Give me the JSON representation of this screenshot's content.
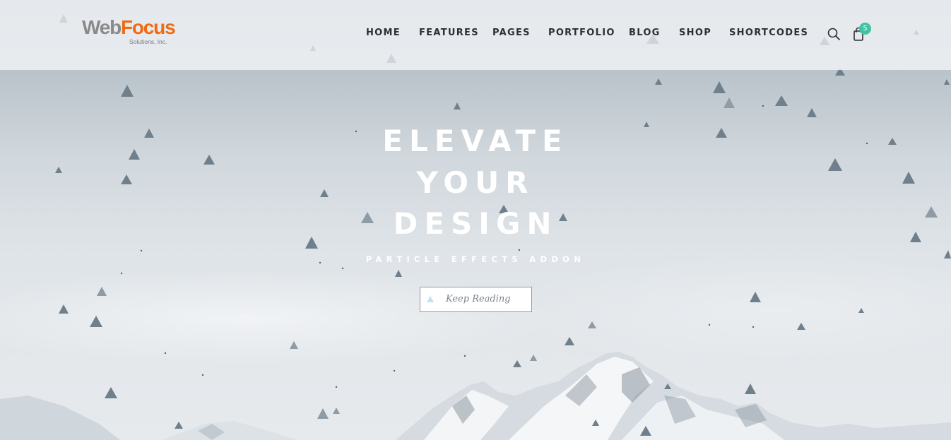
{
  "header": {
    "logo": {
      "brand_first": "Web",
      "brand_second": "Focus",
      "tagline": "Solutions, Inc."
    },
    "nav": [
      {
        "label": "HOME"
      },
      {
        "label": "FEATURES"
      },
      {
        "label": "PAGES"
      },
      {
        "label": "PORTFOLIO"
      },
      {
        "label": "BLOG"
      },
      {
        "label": "SHOP"
      },
      {
        "label": "SHORTCODES"
      }
    ],
    "search_icon": "search-icon",
    "cart_icon": "shopping-bag-icon",
    "cart_count": "5"
  },
  "hero": {
    "headline_lines": [
      "ELEVATE",
      "YOUR",
      "DESIGN"
    ],
    "subheadline": "PARTICLE EFFECTS ADDON",
    "cta_label": "Keep Reading",
    "cta_icon": "triangle-icon"
  },
  "colors": {
    "brand_grey": "#8a8a8a",
    "brand_orange": "#f06a12",
    "badge": "#3fc3a4",
    "nav_text": "#2d2f33",
    "particle": "#6f7f8b"
  }
}
